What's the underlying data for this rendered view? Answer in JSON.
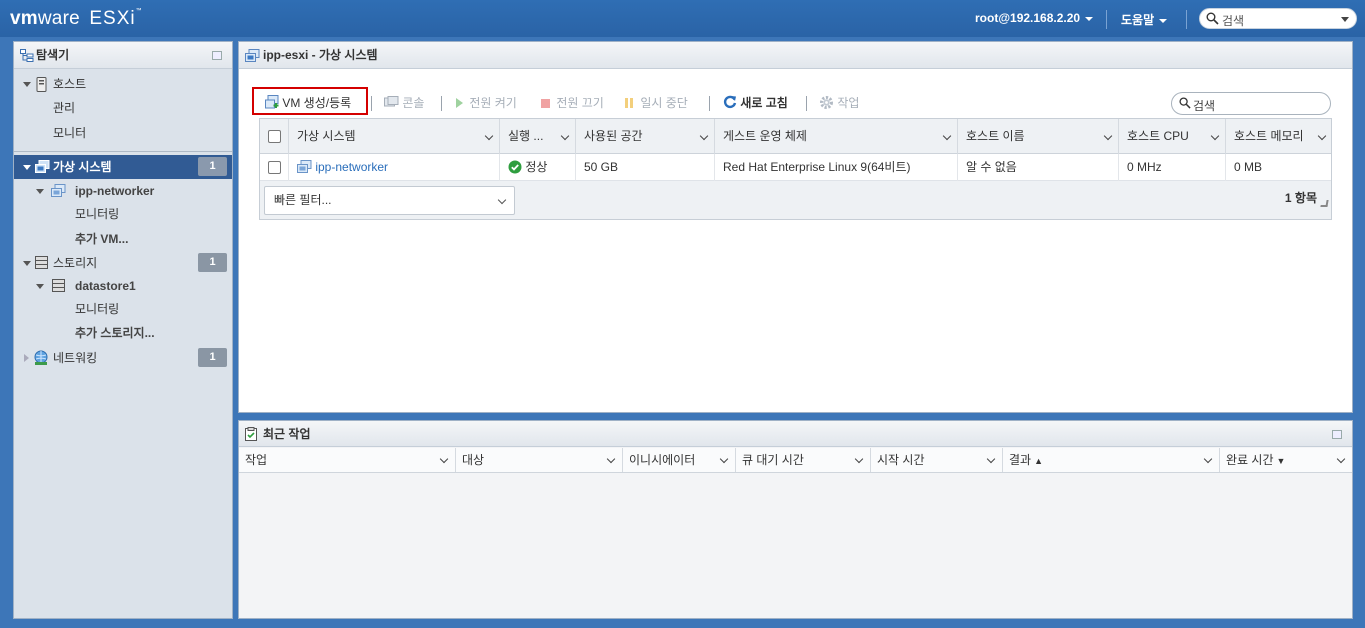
{
  "topbar": {
    "logo_vm": "vm",
    "logo_ware": "ware",
    "logo_product": "ESXi",
    "logo_tm": "™",
    "user": "root@192.168.2.20",
    "help": "도움말",
    "search_placeholder": "검색"
  },
  "navigator": {
    "title": "탐색기",
    "items": [
      {
        "label": "호스트",
        "icon": "host-icon"
      },
      {
        "label": "관리"
      },
      {
        "label": "모니터"
      },
      {
        "label": "가상 시스템",
        "icon": "vm-group-icon",
        "badge": "1",
        "selected": true
      },
      {
        "label": "ipp-networker",
        "icon": "vm-icon"
      },
      {
        "label": "모니터링"
      },
      {
        "label": "추가 VM..."
      },
      {
        "label": "스토리지",
        "icon": "storage-icon",
        "badge": "1"
      },
      {
        "label": "datastore1",
        "icon": "datastore-icon"
      },
      {
        "label": "모니터링"
      },
      {
        "label": "추가 스토리지..."
      },
      {
        "label": "네트워킹",
        "icon": "network-icon",
        "badge": "1"
      }
    ]
  },
  "main": {
    "title": "ipp-esxi - 가상 시스템",
    "toolbar": {
      "create_vm": "VM 생성/등록",
      "console": "콘솔",
      "power_on": "전원 켜기",
      "power_off": "전원 끄기",
      "suspend": "일시 중단",
      "refresh": "새로 고침",
      "actions": "작업"
    },
    "search_placeholder": "검색",
    "columns": [
      "가상 시스템",
      "실행 ...",
      "사용된 공간",
      "게스트 운영 체제",
      "호스트 이름",
      "호스트 CPU",
      "호스트 메모리"
    ],
    "rows": [
      {
        "name": "ipp-networker",
        "state": "정상",
        "used_space": "50 GB",
        "guest_os": "Red Hat Enterprise Linux 9(64비트)",
        "host_name": "알 수 없음",
        "host_cpu": "0 MHz",
        "host_memory": "0 MB"
      }
    ],
    "quick_filter": "빠른 필터...",
    "item_count": "1 항목"
  },
  "tasks": {
    "title": "최근 작업",
    "columns": [
      "작업",
      "대상",
      "이니시에이터",
      "큐 대기 시간",
      "시작 시간",
      "결과",
      "완료 시간"
    ],
    "sort_up": "▲",
    "sort_down": "▼"
  },
  "colors": {
    "topbar": "#2a63a6",
    "selected_nav": "#315b94",
    "link": "#2a6ebb",
    "status_ok": "#2f9e3f",
    "highlight": "#d40000"
  }
}
